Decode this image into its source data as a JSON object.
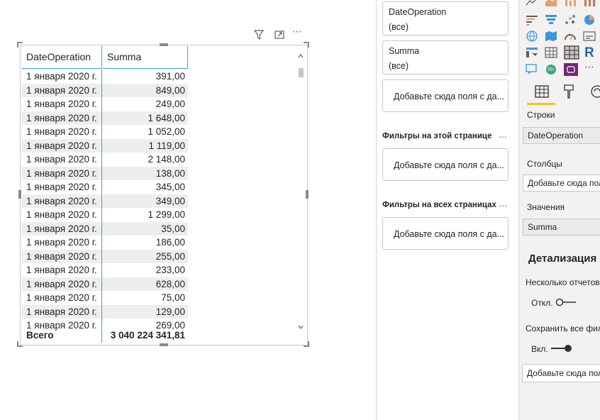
{
  "table": {
    "columns": [
      "DateOperation",
      "Summa"
    ],
    "rows": [
      {
        "date": "1 января 2020 г.",
        "summa": "391,00"
      },
      {
        "date": "1 января 2020 г.",
        "summa": "849,00"
      },
      {
        "date": "1 января 2020 г.",
        "summa": "249,00"
      },
      {
        "date": "1 января 2020 г.",
        "summa": "1 648,00"
      },
      {
        "date": "1 января 2020 г.",
        "summa": "1 052,00"
      },
      {
        "date": "1 января 2020 г.",
        "summa": "1 119,00"
      },
      {
        "date": "1 января 2020 г.",
        "summa": "2 148,00"
      },
      {
        "date": "1 января 2020 г.",
        "summa": "138,00"
      },
      {
        "date": "1 января 2020 г.",
        "summa": "345,00"
      },
      {
        "date": "1 января 2020 г.",
        "summa": "349,00"
      },
      {
        "date": "1 января 2020 г.",
        "summa": "1 299,00"
      },
      {
        "date": "1 января 2020 г.",
        "summa": "35,00"
      },
      {
        "date": "1 января 2020 г.",
        "summa": "186,00"
      },
      {
        "date": "1 января 2020 г.",
        "summa": "255,00"
      },
      {
        "date": "1 января 2020 г.",
        "summa": "233,00"
      },
      {
        "date": "1 января 2020 г.",
        "summa": "628,00"
      },
      {
        "date": "1 января 2020 г.",
        "summa": "75,00"
      },
      {
        "date": "1 января 2020 г.",
        "summa": "129,00"
      },
      {
        "date": "1 января 2020 г.",
        "summa": "269,00"
      }
    ],
    "total": {
      "label": "Всего",
      "summa": "3 040 224 341,81"
    }
  },
  "visual_toolbar": {
    "icons": [
      "filter-icon",
      "focus-mode-icon",
      "more-options-icon"
    ],
    "more": "⋯"
  },
  "filters": {
    "visual_filters": [
      {
        "field": "DateOperation",
        "value": "(все)"
      },
      {
        "field": "Summa",
        "value": "(все)"
      }
    ],
    "add_field_label": "Добавьте сюда поля с да...",
    "page_section": "Фильтры на этой странице",
    "all_pages_section": "Фильтры на всех страницах",
    "more": "⋯"
  },
  "viz": {
    "rows_label": "Строки",
    "rows_field": "DateOperation",
    "columns_label": "Столбцы",
    "columns_field": "Добавьте сюда поля с д",
    "values_label": "Значения",
    "values_field": "Summa",
    "drillthrough_title": "Детализация",
    "cross_report_label": "Несколько отчетов",
    "cross_report_state": "Откл.",
    "keep_filters_label": "Сохранить все фильтры",
    "keep_filters_state": "Вкл.",
    "drill_add_field": "Добавьте сюда поля с д",
    "more": "⋯",
    "r_label": "R",
    "accent": "#f2c811"
  }
}
